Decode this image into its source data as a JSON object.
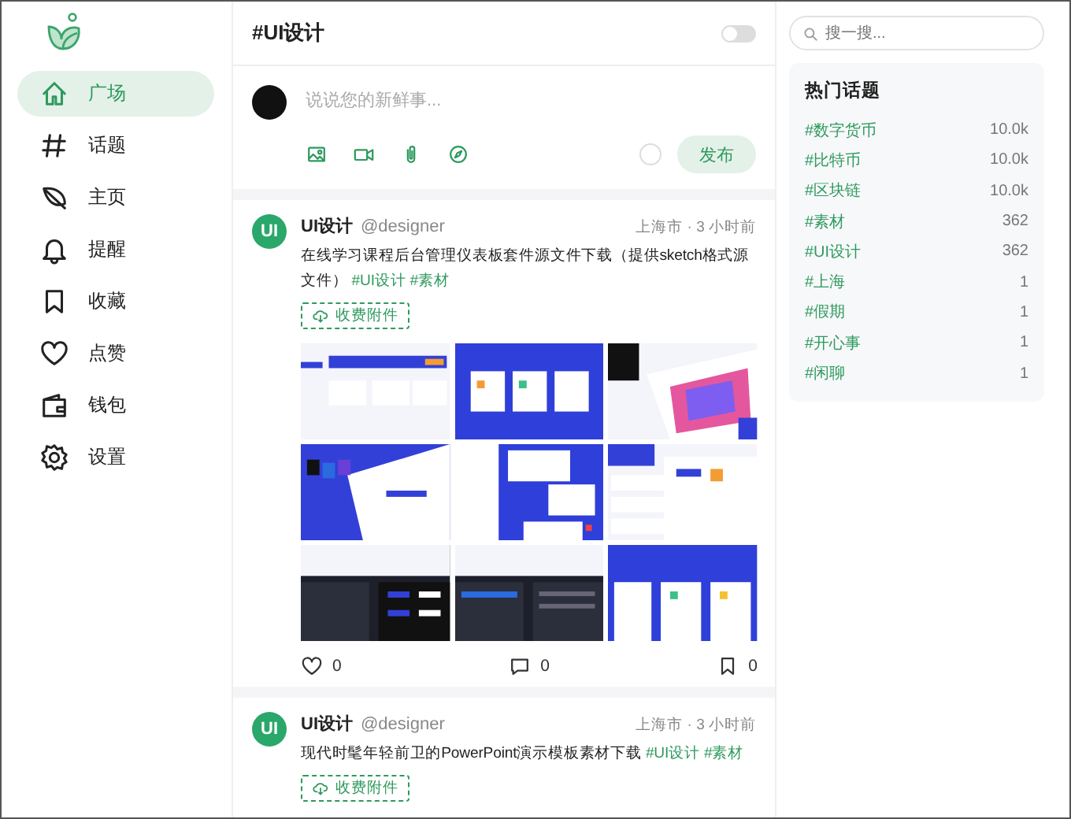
{
  "header": {
    "title": "#UI设计",
    "dark_mode": false
  },
  "nav": [
    {
      "label": "广场",
      "selected": true
    },
    {
      "label": "话题",
      "selected": false
    },
    {
      "label": "主页",
      "selected": false
    },
    {
      "label": "提醒",
      "selected": false
    },
    {
      "label": "收藏",
      "selected": false
    },
    {
      "label": "点赞",
      "selected": false
    },
    {
      "label": "钱包",
      "selected": false
    },
    {
      "label": "设置",
      "selected": false
    }
  ],
  "composer": {
    "placeholder": "说说您的新鲜事...",
    "submit": "发布"
  },
  "posts": [
    {
      "avatar_label": "UI",
      "author": "UI设计",
      "handle": "@designer",
      "meta": "上海市 · 3 小时前",
      "text": "在线学习课程后台管理仪表板套件源文件下载（提供sketch格式源文件）",
      "tags": [
        "#UI设计",
        "#素材"
      ],
      "attachment": "收费附件",
      "images": [
        {
          "kind": "picture"
        },
        {
          "kind": "picture"
        },
        {
          "kind": "picture"
        },
        {
          "kind": "picture"
        },
        {
          "kind": "picture"
        },
        {
          "kind": "picture"
        },
        {
          "kind": "picture"
        },
        {
          "kind": "picture"
        },
        {
          "kind": "picture"
        }
      ],
      "actions": [
        {
          "count": "0"
        },
        {
          "count": "0"
        },
        {
          "count": "0"
        }
      ]
    },
    {
      "avatar_label": "UI",
      "author": "UI设计",
      "handle": "@designer",
      "meta": "上海市 · 3 小时前",
      "text": "现代时髦年轻前卫的PowerPoint演示模板素材下载",
      "tags": [
        "#UI设计",
        "#素材"
      ],
      "attachment": "收费附件"
    }
  ],
  "search": {
    "placeholder": "搜一搜..."
  },
  "trending": {
    "title": "热门话题",
    "items": [
      {
        "tag": "#数字货币",
        "count": "10.0k"
      },
      {
        "tag": "#比特币",
        "count": "10.0k"
      },
      {
        "tag": "#区块链",
        "count": "10.0k"
      },
      {
        "tag": "#素材",
        "count": "362"
      },
      {
        "tag": "#UI设计",
        "count": "362"
      },
      {
        "tag": "#上海",
        "count": "1"
      },
      {
        "tag": "#假期",
        "count": "1"
      },
      {
        "tag": "#开心事",
        "count": "1"
      },
      {
        "tag": "#闲聊",
        "count": "1"
      }
    ]
  }
}
